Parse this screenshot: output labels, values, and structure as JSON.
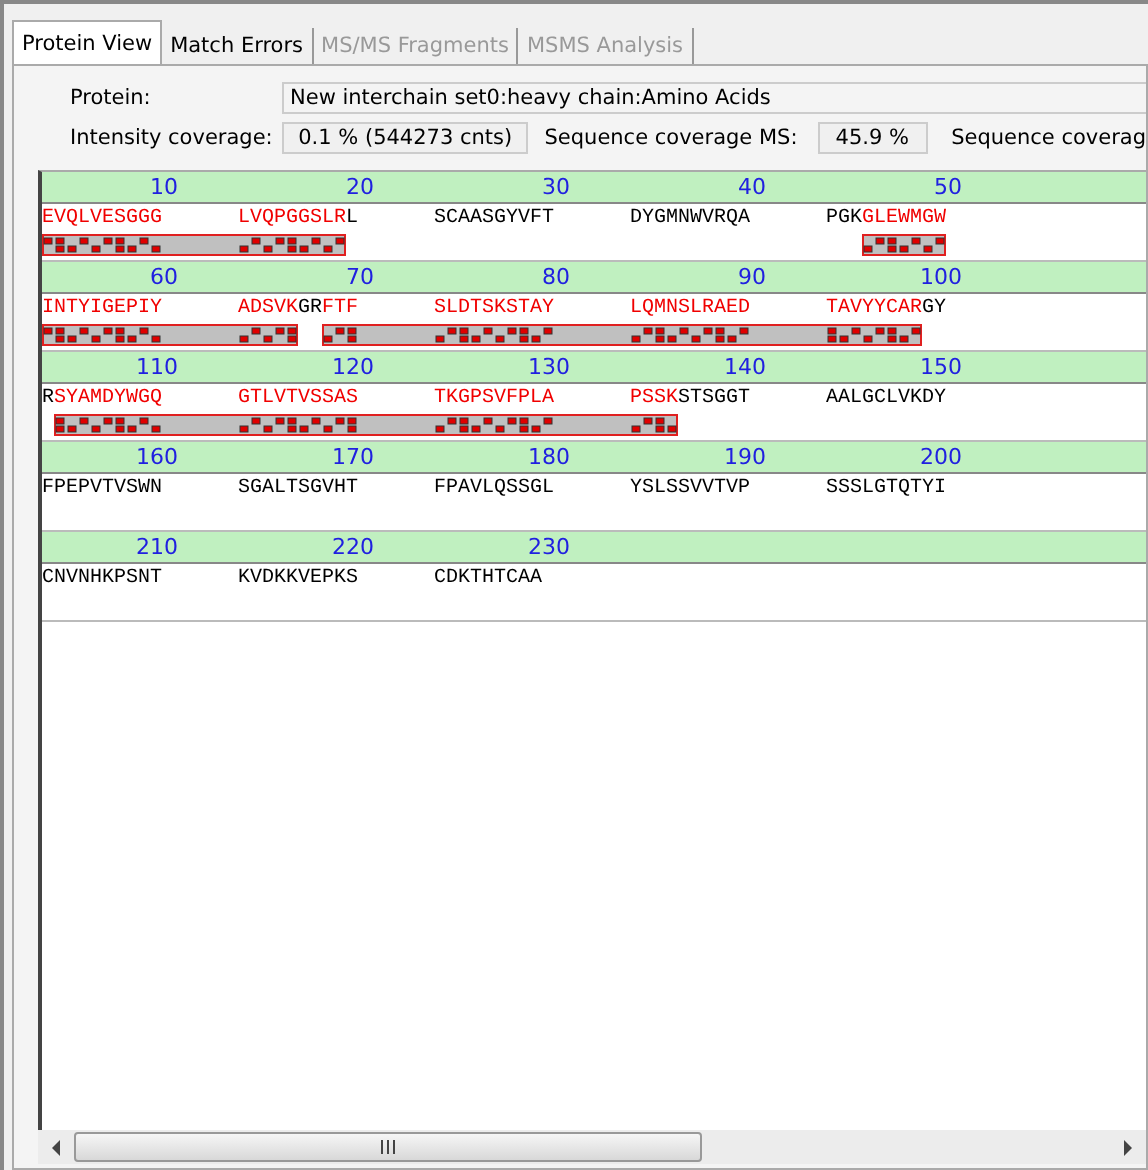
{
  "tabs": [
    {
      "label": "Protein View",
      "selected": true,
      "disabled": false
    },
    {
      "label": "Match Errors",
      "selected": false,
      "disabled": false
    },
    {
      "label": "MS/MS Fragments",
      "selected": false,
      "disabled": true
    },
    {
      "label": "MSMS Analysis",
      "selected": false,
      "disabled": true
    }
  ],
  "protein": {
    "label": "Protein:",
    "value": "New interchain set0:heavy chain:Amino Acids"
  },
  "coverage": {
    "intensity_label": "Intensity coverage:",
    "intensity_value": "0.1 % (544273 cnts)",
    "ms_label": "Sequence coverage MS:",
    "ms_value": "45.9 %",
    "next_label": "Sequence coverag"
  },
  "sequence_rows": [
    {
      "blocks": [
        {
          "number": "10",
          "runs": [
            {
              "text": "EVQLVESGGG",
              "covered": true
            }
          ]
        },
        {
          "number": "20",
          "runs": [
            {
              "text": "LVQPGGSLR",
              "covered": true
            },
            {
              "text": "L",
              "covered": false
            }
          ]
        },
        {
          "number": "30",
          "runs": [
            {
              "text": "SCAASGYVFT",
              "covered": false
            }
          ]
        },
        {
          "number": "40",
          "runs": [
            {
              "text": "DYGMNWVRQA",
              "covered": false
            }
          ]
        },
        {
          "number": "50",
          "runs": [
            {
              "text": "PGK",
              "covered": false
            },
            {
              "text": "GLEWMGW",
              "covered": true
            }
          ]
        }
      ]
    },
    {
      "blocks": [
        {
          "number": "60",
          "runs": [
            {
              "text": "INTYIGEPIY",
              "covered": true
            }
          ]
        },
        {
          "number": "70",
          "runs": [
            {
              "text": "ADSVK",
              "covered": true
            },
            {
              "text": "GR",
              "covered": false
            },
            {
              "text": "FTF",
              "covered": true
            }
          ]
        },
        {
          "number": "80",
          "runs": [
            {
              "text": "SLDTSKSTAY",
              "covered": true
            }
          ]
        },
        {
          "number": "90",
          "runs": [
            {
              "text": "LQMNSLRAED",
              "covered": true
            }
          ]
        },
        {
          "number": "100",
          "runs": [
            {
              "text": "TAVYYCAR",
              "covered": true
            },
            {
              "text": "GY",
              "covered": false
            }
          ]
        }
      ]
    },
    {
      "blocks": [
        {
          "number": "110",
          "runs": [
            {
              "text": "R",
              "covered": false
            },
            {
              "text": "SYAMDYWGQ",
              "covered": true
            }
          ]
        },
        {
          "number": "120",
          "runs": [
            {
              "text": "GTLVTVSSAS",
              "covered": true
            }
          ]
        },
        {
          "number": "130",
          "runs": [
            {
              "text": "TKGPSVFPLA",
              "covered": true
            }
          ]
        },
        {
          "number": "140",
          "runs": [
            {
              "text": "PSSK",
              "covered": true
            },
            {
              "text": "STSGGT",
              "covered": false
            }
          ]
        },
        {
          "number": "150",
          "runs": [
            {
              "text": "AALGCLVKDY",
              "covered": false
            }
          ]
        }
      ]
    },
    {
      "blocks": [
        {
          "number": "160",
          "runs": [
            {
              "text": "FPEPVTVSWN",
              "covered": false
            }
          ]
        },
        {
          "number": "170",
          "runs": [
            {
              "text": "SGALTSGVHT",
              "covered": false
            }
          ]
        },
        {
          "number": "180",
          "runs": [
            {
              "text": "FPAVLQSSGL",
              "covered": false
            }
          ]
        },
        {
          "number": "190",
          "runs": [
            {
              "text": "YSLSSVVTVP",
              "covered": false
            }
          ]
        },
        {
          "number": "200",
          "runs": [
            {
              "text": "SSSLGTQTYI",
              "covered": false
            }
          ]
        }
      ]
    },
    {
      "blocks": [
        {
          "number": "210",
          "runs": [
            {
              "text": "CNVNHKPSNT",
              "covered": false
            }
          ]
        },
        {
          "number": "220",
          "runs": [
            {
              "text": "KVDKKVEPKS",
              "covered": false
            }
          ]
        },
        {
          "number": "230",
          "runs": [
            {
              "text": "CDKTHTCAA",
              "covered": false
            }
          ]
        }
      ]
    }
  ]
}
